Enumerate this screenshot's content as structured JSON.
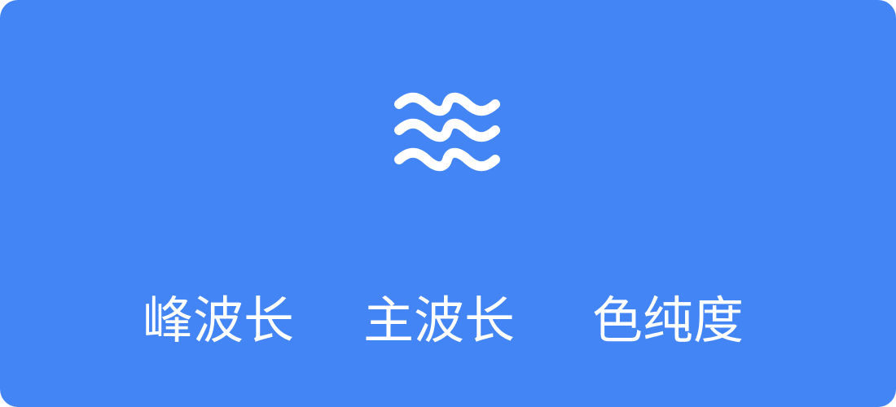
{
  "card": {
    "background_color": "#4385f5",
    "foreground_color": "#ffffff",
    "icon": "water-waves-icon",
    "labels": [
      "峰波长",
      "主波长",
      "色纯度"
    ]
  }
}
